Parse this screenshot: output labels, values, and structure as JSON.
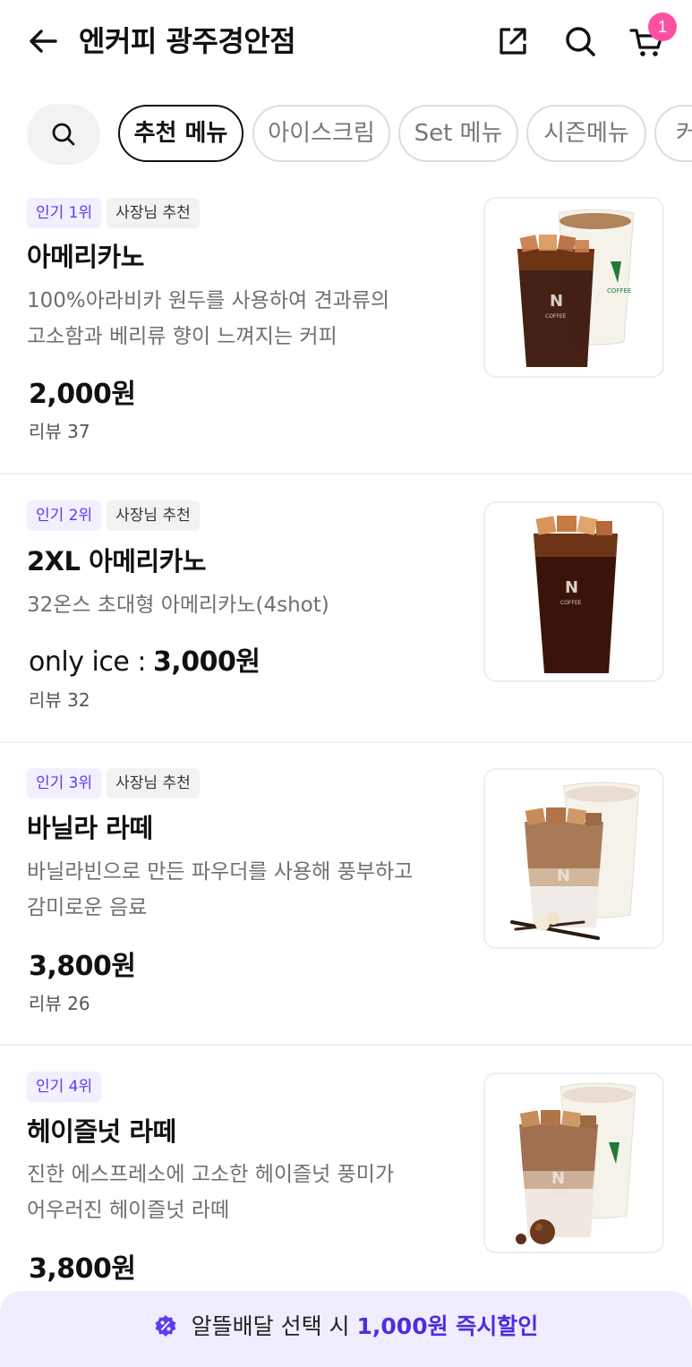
{
  "header": {
    "title": "엔커피 광주경안점",
    "cart_count": "1"
  },
  "tabs": [
    {
      "label": "추천 메뉴",
      "active": true
    },
    {
      "label": "아이스크림",
      "active": false
    },
    {
      "label": "Set 메뉴",
      "active": false
    },
    {
      "label": "시즌메뉴",
      "active": false
    },
    {
      "label": "커",
      "active": false
    }
  ],
  "items": [
    {
      "rank": "인기 1위",
      "owner_pick": "사장님 추천",
      "name": "아메리카노",
      "desc_line1": "100%아라비카 원두를 사용하여 견과류의",
      "desc_line2": "고소함과 베리류 향이 느껴지는 커피",
      "price": "2,000원",
      "review": "리뷰 37"
    },
    {
      "rank": "인기 2위",
      "owner_pick": "사장님 추천",
      "name": "2XL 아메리카노",
      "desc_line1": "32온스 초대형 아메리카노(4shot)",
      "price_prefix": "only ice :",
      "price": "3,000원",
      "review": "리뷰 32"
    },
    {
      "rank": "인기 3위",
      "owner_pick": "사장님 추천",
      "name": "바닐라 라떼",
      "desc_line1": "바닐라빈으로 만든 파우더를 사용해 풍부하고",
      "desc_line2": "감미로운 음료",
      "price": "3,800원",
      "review": "리뷰 26"
    },
    {
      "rank": "인기 4위",
      "name": "헤이즐넛 라떼",
      "desc_line1": "진한 에스프레소에 고소한 헤이즐넛 풍미가",
      "desc_line2": "어우러진 헤이즐넛 라떼",
      "price": "3,800원"
    }
  ],
  "cup_brand": {
    "logo": "N",
    "text": "COFFEE"
  },
  "promo": {
    "text_before": "알뜰배달 선택 시",
    "text_highlight": "1,000원 즉시할인"
  },
  "colors": {
    "accent": "#5b3cf2",
    "badge_pink": "#ff4fa3",
    "promo_bg": "#f0edff"
  }
}
